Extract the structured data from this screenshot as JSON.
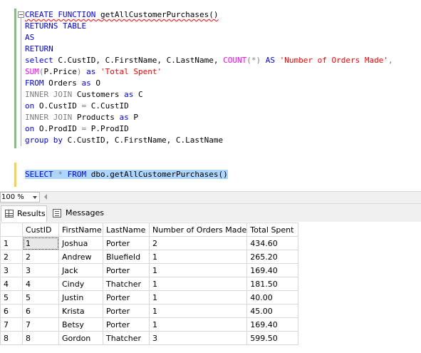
{
  "editor": {
    "lines": [
      [
        {
          "t": "CREATE FUNCTION ",
          "c": "kw squig"
        },
        {
          "t": "getAllCustomerPurchases()",
          "c": "squig"
        }
      ],
      [
        {
          "t": "RETURNS TABLE",
          "c": "kw"
        }
      ],
      [
        {
          "t": "AS",
          "c": "kw"
        }
      ],
      [
        {
          "t": "RETURN",
          "c": "kw"
        }
      ],
      [
        {
          "t": "select ",
          "c": "kw"
        },
        {
          "t": "C.CustID, C.FirstName, C.LastName, ",
          "c": ""
        },
        {
          "t": "COUNT",
          "c": "fn"
        },
        {
          "t": "(*) ",
          "c": "gray"
        },
        {
          "t": "AS ",
          "c": "kw"
        },
        {
          "t": "'Number of Orders Made'",
          "c": "str"
        },
        {
          "t": ",",
          "c": "gray"
        }
      ],
      [
        {
          "t": "SUM",
          "c": "fn"
        },
        {
          "t": "(",
          "c": "gray"
        },
        {
          "t": "P.Price",
          "c": ""
        },
        {
          "t": ") ",
          "c": "gray"
        },
        {
          "t": "as ",
          "c": "kw"
        },
        {
          "t": "'Total Spent'",
          "c": "str"
        }
      ],
      [
        {
          "t": "FROM ",
          "c": "kw"
        },
        {
          "t": "Orders ",
          "c": ""
        },
        {
          "t": "as ",
          "c": "kw"
        },
        {
          "t": "O",
          "c": ""
        }
      ],
      [
        {
          "t": "INNER JOIN ",
          "c": "gray"
        },
        {
          "t": "Customers ",
          "c": ""
        },
        {
          "t": "as ",
          "c": "kw"
        },
        {
          "t": "C",
          "c": ""
        }
      ],
      [
        {
          "t": "on ",
          "c": "kw"
        },
        {
          "t": "O.CustID ",
          "c": ""
        },
        {
          "t": "= ",
          "c": "gray"
        },
        {
          "t": "C.CustID",
          "c": ""
        }
      ],
      [
        {
          "t": "INNER JOIN ",
          "c": "gray"
        },
        {
          "t": "Products ",
          "c": ""
        },
        {
          "t": "as ",
          "c": "kw"
        },
        {
          "t": "P",
          "c": ""
        }
      ],
      [
        {
          "t": "on ",
          "c": "kw"
        },
        {
          "t": "O.ProdID ",
          "c": ""
        },
        {
          "t": "= ",
          "c": "gray"
        },
        {
          "t": "P.ProdID",
          "c": ""
        }
      ],
      [
        {
          "t": "group by ",
          "c": "kw"
        },
        {
          "t": "C.CustID, C.FirstName, C.LastName",
          "c": ""
        }
      ],
      [],
      [],
      [
        {
          "t": "SELECT ",
          "c": "kw sel"
        },
        {
          "t": "* ",
          "c": "gray sel"
        },
        {
          "t": "FROM ",
          "c": "kw sel"
        },
        {
          "t": "dbo.getAllCustomerPurchases()",
          "c": "sel"
        }
      ]
    ]
  },
  "zoom": {
    "value": "100 %"
  },
  "tabs": {
    "results": "Results",
    "messages": "Messages"
  },
  "grid": {
    "columns": [
      "CustID",
      "FirstName",
      "LastName",
      "Number of Orders Made",
      "Total Spent"
    ],
    "rows": [
      [
        "1",
        "1",
        "Joshua",
        "Porter",
        "2",
        "434.60"
      ],
      [
        "2",
        "2",
        "Andrew",
        "Bluefield",
        "1",
        "265.20"
      ],
      [
        "3",
        "3",
        "Jack",
        "Porter",
        "1",
        "169.40"
      ],
      [
        "4",
        "4",
        "Cindy",
        "Thatcher",
        "1",
        "181.50"
      ],
      [
        "5",
        "5",
        "Justin",
        "Porter",
        "1",
        "40.00"
      ],
      [
        "6",
        "6",
        "Krista",
        "Porter",
        "1",
        "45.00"
      ],
      [
        "7",
        "7",
        "Betsy",
        "Porter",
        "1",
        "169.40"
      ],
      [
        "8",
        "8",
        "Gordon",
        "Thatcher",
        "3",
        "599.50"
      ]
    ]
  }
}
